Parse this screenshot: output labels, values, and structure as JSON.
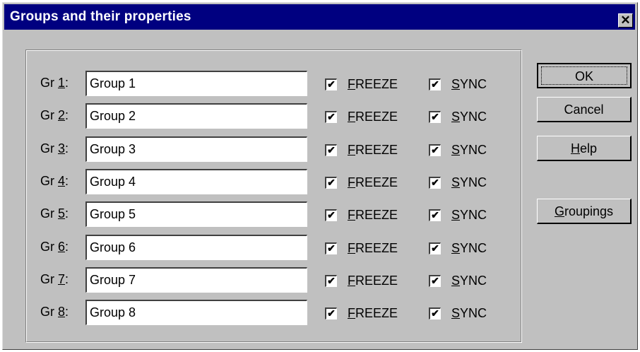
{
  "window": {
    "title": "Groups and their properties",
    "close_glyph": "✕"
  },
  "groups": [
    {
      "label_prefix": "Gr ",
      "accel": "1",
      "label_suffix": ":",
      "name": "Group 1",
      "freeze_checked": true,
      "sync_checked": true
    },
    {
      "label_prefix": "Gr ",
      "accel": "2",
      "label_suffix": ":",
      "name": "Group 2",
      "freeze_checked": true,
      "sync_checked": true
    },
    {
      "label_prefix": "Gr ",
      "accel": "3",
      "label_suffix": ":",
      "name": "Group 3",
      "freeze_checked": true,
      "sync_checked": true
    },
    {
      "label_prefix": "Gr ",
      "accel": "4",
      "label_suffix": ":",
      "name": "Group 4",
      "freeze_checked": true,
      "sync_checked": true
    },
    {
      "label_prefix": "Gr ",
      "accel": "5",
      "label_suffix": ":",
      "name": "Group 5",
      "freeze_checked": true,
      "sync_checked": true
    },
    {
      "label_prefix": "Gr ",
      "accel": "6",
      "label_suffix": ":",
      "name": "Group 6",
      "freeze_checked": true,
      "sync_checked": true
    },
    {
      "label_prefix": "Gr ",
      "accel": "7",
      "label_suffix": ":",
      "name": "Group 7",
      "freeze_checked": true,
      "sync_checked": true
    },
    {
      "label_prefix": "Gr ",
      "accel": "8",
      "label_suffix": ":",
      "name": "Group 8",
      "freeze_checked": true,
      "sync_checked": true
    }
  ],
  "checkbox_labels": {
    "freeze": {
      "accel": "F",
      "rest": "REEZE"
    },
    "sync": {
      "accel": "S",
      "rest": "YNC"
    }
  },
  "buttons": {
    "ok": "OK",
    "cancel": "Cancel",
    "help": {
      "accel": "H",
      "rest": "elp"
    },
    "groupings": {
      "accel": "G",
      "rest": "roupings"
    }
  },
  "checkmark_glyph": "✔",
  "colors": {
    "titlebar": "#000080",
    "dialog_bg": "#c0c0c0",
    "field_bg": "#ffffff"
  }
}
